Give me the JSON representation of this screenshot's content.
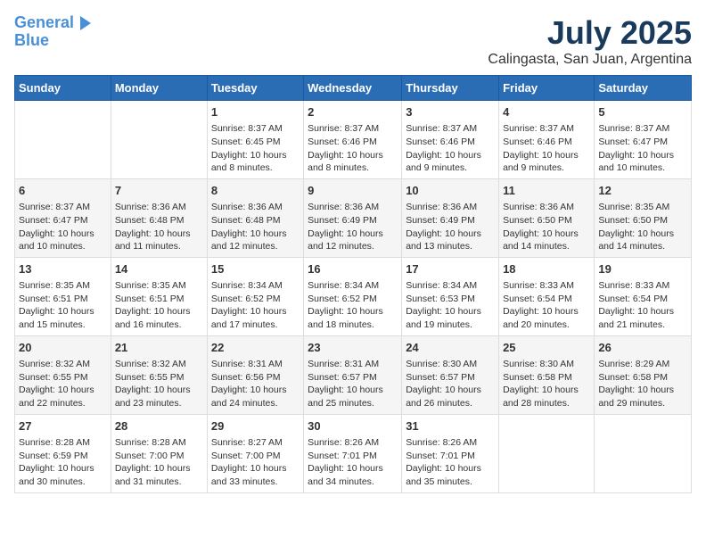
{
  "header": {
    "logo_line1": "General",
    "logo_line2": "Blue",
    "month_title": "July 2025",
    "location": "Calingasta, San Juan, Argentina"
  },
  "days_of_week": [
    "Sunday",
    "Monday",
    "Tuesday",
    "Wednesday",
    "Thursday",
    "Friday",
    "Saturday"
  ],
  "weeks": [
    [
      {
        "day": "",
        "info": ""
      },
      {
        "day": "",
        "info": ""
      },
      {
        "day": "1",
        "info": "Sunrise: 8:37 AM\nSunset: 6:45 PM\nDaylight: 10 hours and 8 minutes."
      },
      {
        "day": "2",
        "info": "Sunrise: 8:37 AM\nSunset: 6:46 PM\nDaylight: 10 hours and 8 minutes."
      },
      {
        "day": "3",
        "info": "Sunrise: 8:37 AM\nSunset: 6:46 PM\nDaylight: 10 hours and 9 minutes."
      },
      {
        "day": "4",
        "info": "Sunrise: 8:37 AM\nSunset: 6:46 PM\nDaylight: 10 hours and 9 minutes."
      },
      {
        "day": "5",
        "info": "Sunrise: 8:37 AM\nSunset: 6:47 PM\nDaylight: 10 hours and 10 minutes."
      }
    ],
    [
      {
        "day": "6",
        "info": "Sunrise: 8:37 AM\nSunset: 6:47 PM\nDaylight: 10 hours and 10 minutes."
      },
      {
        "day": "7",
        "info": "Sunrise: 8:36 AM\nSunset: 6:48 PM\nDaylight: 10 hours and 11 minutes."
      },
      {
        "day": "8",
        "info": "Sunrise: 8:36 AM\nSunset: 6:48 PM\nDaylight: 10 hours and 12 minutes."
      },
      {
        "day": "9",
        "info": "Sunrise: 8:36 AM\nSunset: 6:49 PM\nDaylight: 10 hours and 12 minutes."
      },
      {
        "day": "10",
        "info": "Sunrise: 8:36 AM\nSunset: 6:49 PM\nDaylight: 10 hours and 13 minutes."
      },
      {
        "day": "11",
        "info": "Sunrise: 8:36 AM\nSunset: 6:50 PM\nDaylight: 10 hours and 14 minutes."
      },
      {
        "day": "12",
        "info": "Sunrise: 8:35 AM\nSunset: 6:50 PM\nDaylight: 10 hours and 14 minutes."
      }
    ],
    [
      {
        "day": "13",
        "info": "Sunrise: 8:35 AM\nSunset: 6:51 PM\nDaylight: 10 hours and 15 minutes."
      },
      {
        "day": "14",
        "info": "Sunrise: 8:35 AM\nSunset: 6:51 PM\nDaylight: 10 hours and 16 minutes."
      },
      {
        "day": "15",
        "info": "Sunrise: 8:34 AM\nSunset: 6:52 PM\nDaylight: 10 hours and 17 minutes."
      },
      {
        "day": "16",
        "info": "Sunrise: 8:34 AM\nSunset: 6:52 PM\nDaylight: 10 hours and 18 minutes."
      },
      {
        "day": "17",
        "info": "Sunrise: 8:34 AM\nSunset: 6:53 PM\nDaylight: 10 hours and 19 minutes."
      },
      {
        "day": "18",
        "info": "Sunrise: 8:33 AM\nSunset: 6:54 PM\nDaylight: 10 hours and 20 minutes."
      },
      {
        "day": "19",
        "info": "Sunrise: 8:33 AM\nSunset: 6:54 PM\nDaylight: 10 hours and 21 minutes."
      }
    ],
    [
      {
        "day": "20",
        "info": "Sunrise: 8:32 AM\nSunset: 6:55 PM\nDaylight: 10 hours and 22 minutes."
      },
      {
        "day": "21",
        "info": "Sunrise: 8:32 AM\nSunset: 6:55 PM\nDaylight: 10 hours and 23 minutes."
      },
      {
        "day": "22",
        "info": "Sunrise: 8:31 AM\nSunset: 6:56 PM\nDaylight: 10 hours and 24 minutes."
      },
      {
        "day": "23",
        "info": "Sunrise: 8:31 AM\nSunset: 6:57 PM\nDaylight: 10 hours and 25 minutes."
      },
      {
        "day": "24",
        "info": "Sunrise: 8:30 AM\nSunset: 6:57 PM\nDaylight: 10 hours and 26 minutes."
      },
      {
        "day": "25",
        "info": "Sunrise: 8:30 AM\nSunset: 6:58 PM\nDaylight: 10 hours and 28 minutes."
      },
      {
        "day": "26",
        "info": "Sunrise: 8:29 AM\nSunset: 6:58 PM\nDaylight: 10 hours and 29 minutes."
      }
    ],
    [
      {
        "day": "27",
        "info": "Sunrise: 8:28 AM\nSunset: 6:59 PM\nDaylight: 10 hours and 30 minutes."
      },
      {
        "day": "28",
        "info": "Sunrise: 8:28 AM\nSunset: 7:00 PM\nDaylight: 10 hours and 31 minutes."
      },
      {
        "day": "29",
        "info": "Sunrise: 8:27 AM\nSunset: 7:00 PM\nDaylight: 10 hours and 33 minutes."
      },
      {
        "day": "30",
        "info": "Sunrise: 8:26 AM\nSunset: 7:01 PM\nDaylight: 10 hours and 34 minutes."
      },
      {
        "day": "31",
        "info": "Sunrise: 8:26 AM\nSunset: 7:01 PM\nDaylight: 10 hours and 35 minutes."
      },
      {
        "day": "",
        "info": ""
      },
      {
        "day": "",
        "info": ""
      }
    ]
  ]
}
